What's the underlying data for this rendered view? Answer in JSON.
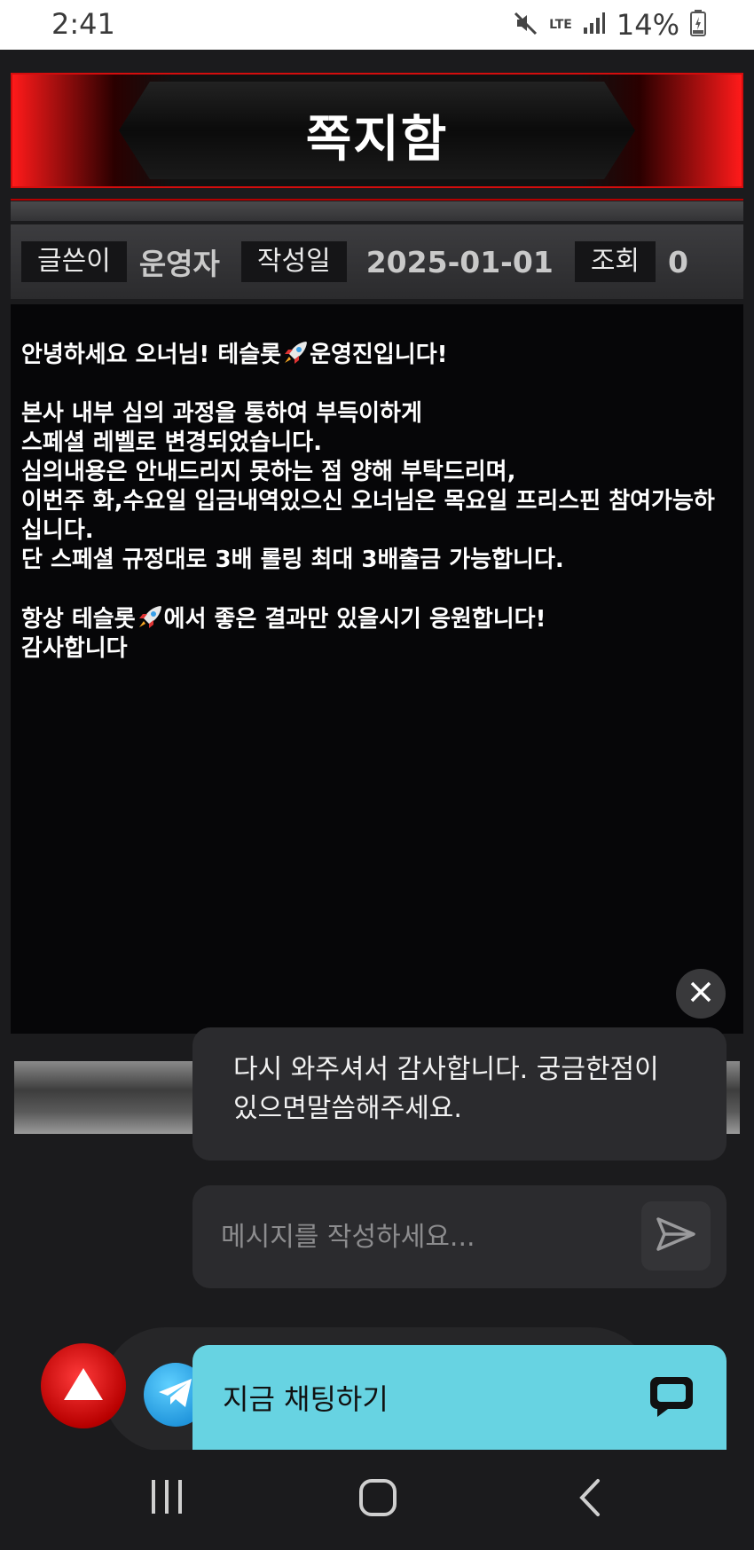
{
  "status_bar": {
    "time": "2:41",
    "network": "LTE",
    "battery": "14%"
  },
  "page": {
    "title": "쪽지함"
  },
  "meta": {
    "author_label": "글쓴이",
    "author": "운영자",
    "date_label": "작성일",
    "date": "2025-01-01",
    "views_label": "조회",
    "views": "0"
  },
  "message": {
    "lines": [
      {
        "before": "안녕하세요 오너님! 테슬롯",
        "after": "운영진입니다!"
      },
      "본사 내부 심의 과정을 통하여 부득이하게",
      "스페셜 레벨로 변경되었습니다.",
      "심의내용은 안내드리지 못하는 점 양해 부탁드리며,",
      "이번주 화,수요일 입금내역있으신 오너님은 목요일 프리스핀 참여가능하십니다.",
      "단 스페셜 규정대로 3배 롤링 최대 3배출금 가능합니다.",
      {
        "before": "항상 테슬롯",
        "after": "에서 좋은 결과만 있을시기 응원합니다!"
      },
      "감사합니다"
    ]
  },
  "chat_widget": {
    "bubble_text": "다시 와주셔서 감사합니다. 궁금한점이 있으면말씀해주세요.",
    "input_placeholder": "메시지를 작성하세요...",
    "chat_now_label": "지금 채팅하기"
  },
  "colors": {
    "banner_red": "#d40d0d",
    "chat_now_bg": "#67d3e2",
    "content_bg": "#060608"
  },
  "icons": [
    "mute-icon",
    "signal-icon",
    "battery-icon",
    "rocket-icon",
    "close-icon",
    "send-icon",
    "up-arrow-icon",
    "telegram-icon",
    "chat-bubble-icon",
    "recent-apps-icon",
    "home-icon",
    "back-icon"
  ]
}
